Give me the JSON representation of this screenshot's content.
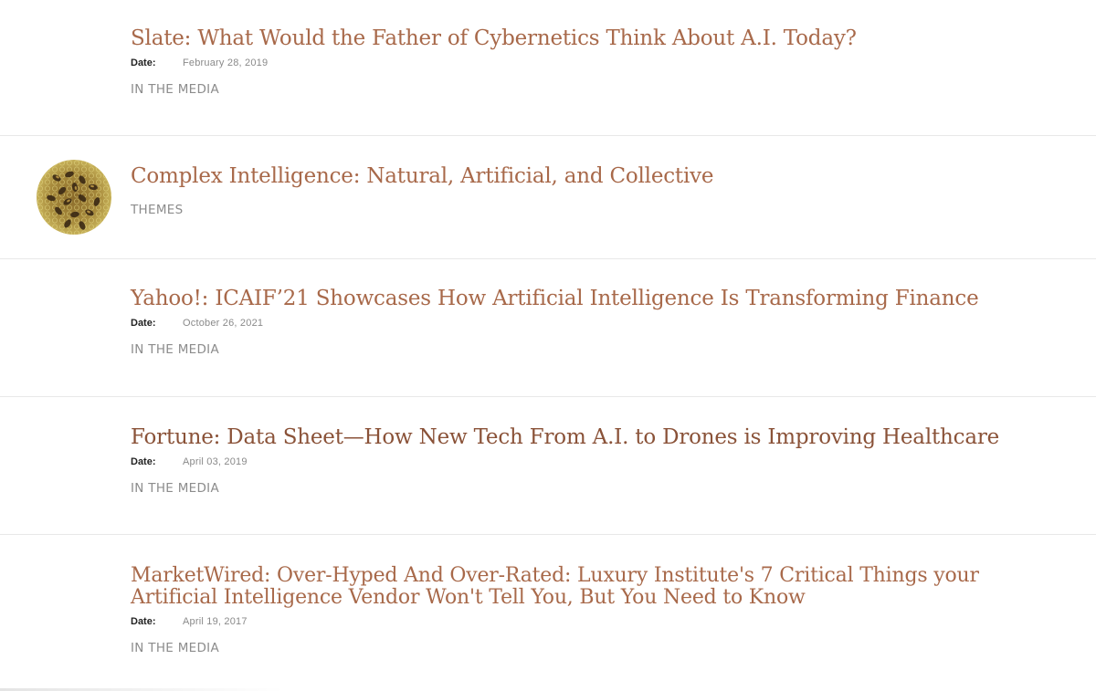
{
  "results": [
    {
      "title": "Slate: What Would the Father of Cybernetics Think About A.I. Today?",
      "date_label": "Date:",
      "date": "February 28, 2019",
      "category": "IN THE MEDIA"
    },
    {
      "title": "Complex Intelligence: Natural, Artificial, and Collective",
      "category": "THEMES",
      "thumbnail_icon": "honeybees-thumbnail"
    },
    {
      "title": "Yahoo!: ICAIF’21 Showcases How Artificial Intelligence Is Transforming Finance",
      "date_label": "Date:",
      "date": "October 26, 2021",
      "category": "IN THE MEDIA"
    },
    {
      "title": "Fortune: Data Sheet—How New Tech From A.I. to Drones is Improving Healthcare",
      "date_label": "Date:",
      "date": "April 03, 2019",
      "category": "IN THE MEDIA"
    },
    {
      "title": "MarketWired: Over-Hyped And Over-Rated: Luxury Institute's 7 Critical Things your Artificial Intelligence Vendor Won't Tell You, But You Need to Know",
      "date_label": "Date:",
      "date": "April 19, 2017",
      "category": "IN THE MEDIA"
    }
  ],
  "colors": {
    "title": "#a8694a",
    "category": "#8c8c8c",
    "divider": "#e8e8e8"
  }
}
